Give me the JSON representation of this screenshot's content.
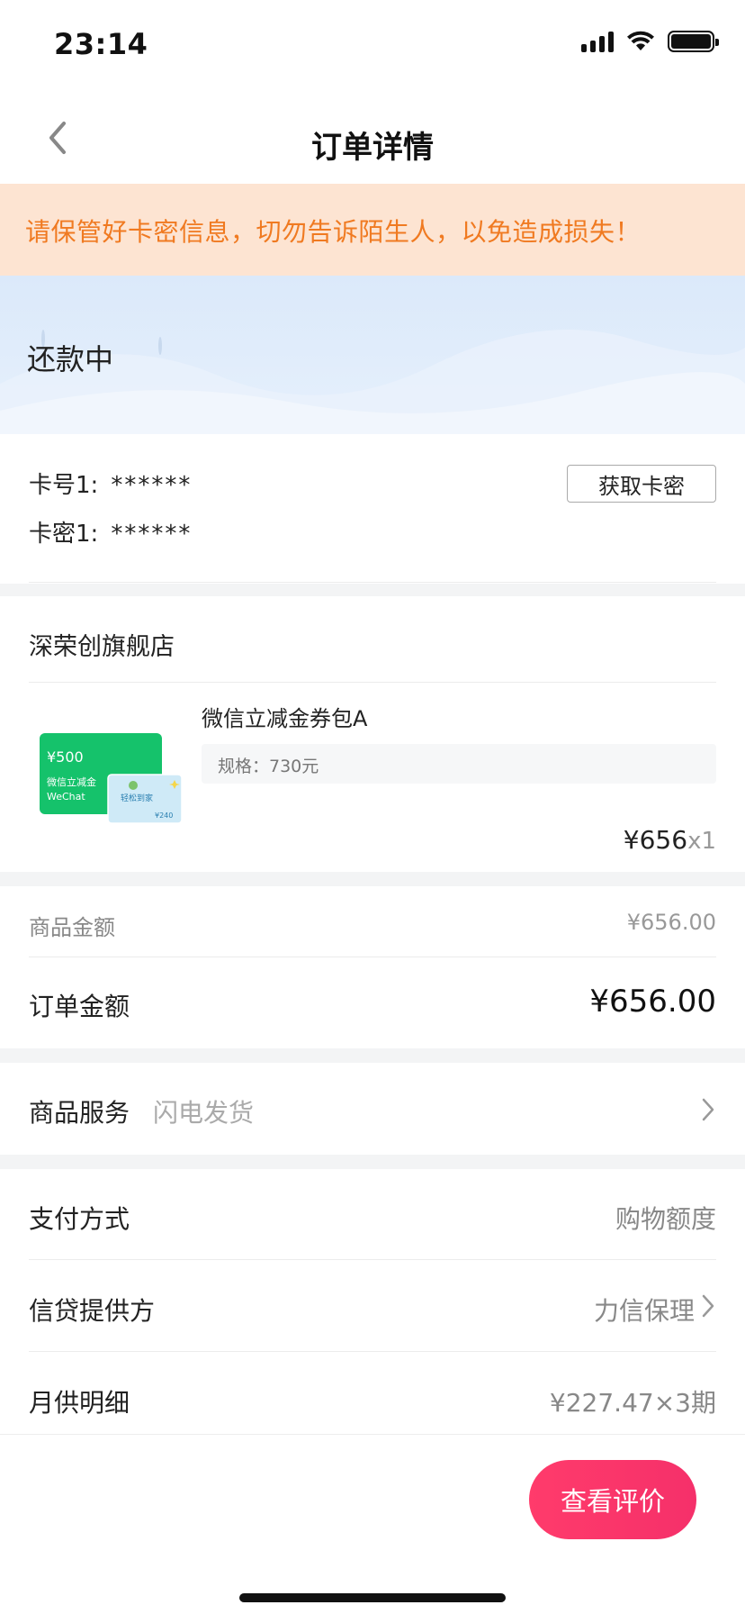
{
  "status_bar": {
    "time": "23:14"
  },
  "nav": {
    "title": "订单详情"
  },
  "warning": {
    "text": "请保管好卡密信息，切勿告诉陌生人，以免造成损失！"
  },
  "order_status": {
    "label": "还款中"
  },
  "card": {
    "number_label": "卡号1:",
    "number_value": "******",
    "secret_label": "卡密1:",
    "secret_value": "******",
    "get_key_button": "获取卡密"
  },
  "store": {
    "name": "深荣创旗舰店"
  },
  "product": {
    "name": "微信立减金券包A",
    "spec": "规格：730元",
    "price": "¥656",
    "quantity": "x1",
    "image": {
      "main_amount": "¥500",
      "main_line1": "微信立减金",
      "main_line2": "WeChat",
      "sub_title": "轻松到家",
      "sub_amount": "¥240"
    }
  },
  "amounts": {
    "goods_label": "商品金额",
    "goods_value": "¥656.00",
    "order_label": "订单金额",
    "order_value": "¥656.00"
  },
  "service": {
    "label": "商品服务",
    "value": "闪电发货"
  },
  "payment": {
    "method_label": "支付方式",
    "method_value": "购物额度",
    "provider_label": "信贷提供方",
    "provider_value": "力信保理",
    "monthly_label": "月供明细",
    "monthly_value": "¥227.47×3期"
  },
  "actions": {
    "review_button": "查看评价"
  },
  "colors": {
    "warning_text": "#f07a21",
    "warning_bg": "#fde4d2",
    "accent_pink": "#ff3b6b",
    "wechat_green": "#15c26b"
  },
  "icons": [
    "back-chevron-icon",
    "signal-icon",
    "wifi-icon",
    "battery-icon",
    "chevron-right-icon"
  ]
}
